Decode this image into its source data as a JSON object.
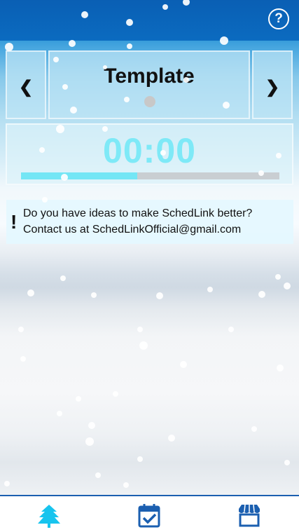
{
  "header": {
    "help_label": "?"
  },
  "template_selector": {
    "prev_label": "❮",
    "title": "Template",
    "next_label": "❯"
  },
  "timer": {
    "display": "00:00",
    "progress_fraction": 0.45
  },
  "info": {
    "icon": "!",
    "line1": "Do you have ideas to make SchedLink better?",
    "line2": "Contact us at SchedLinkOfficial@gmail.com"
  },
  "bottom_nav": {
    "items": [
      {
        "icon": "tree-icon",
        "color": "#17c4ee"
      },
      {
        "icon": "calendar-check-icon",
        "color": "#1b5fb0"
      },
      {
        "icon": "shop-icon",
        "color": "#1b5fb0"
      }
    ]
  }
}
